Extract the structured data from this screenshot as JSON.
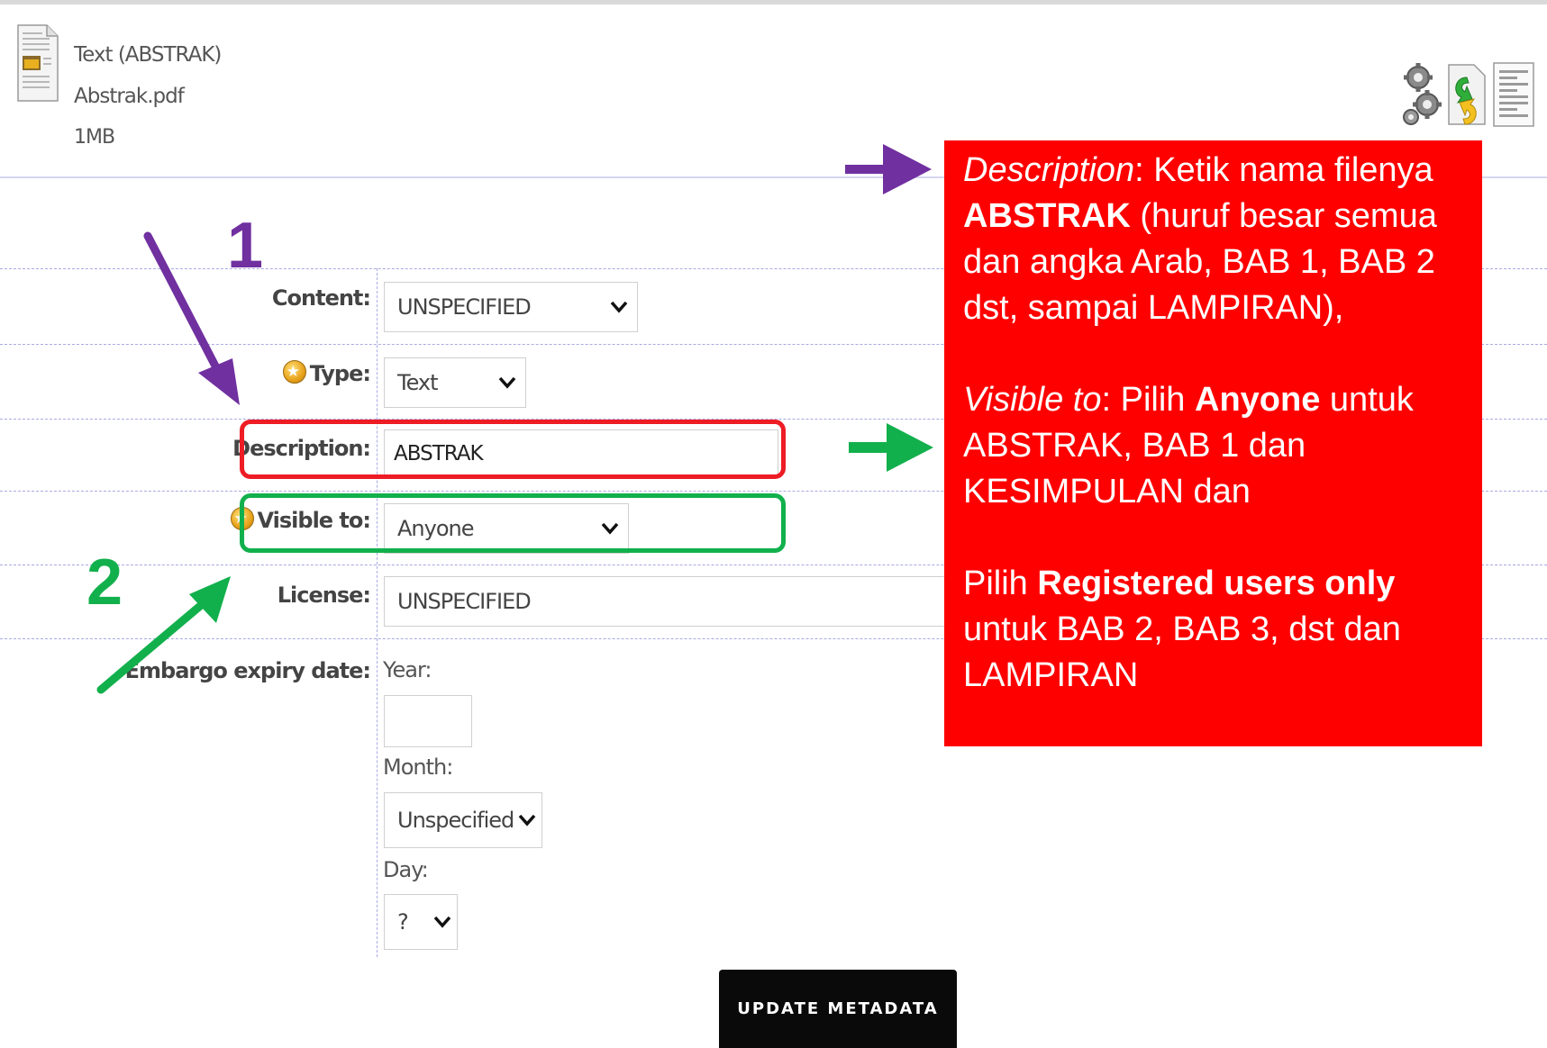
{
  "file": {
    "title": "Text (ABSTRAK)",
    "filename": "Abstrak.pdf",
    "size": "1MB"
  },
  "form": {
    "content": {
      "label": "Content:",
      "value": "UNSPECIFIED"
    },
    "type": {
      "label": "Type:",
      "value": "Text"
    },
    "description": {
      "label": "Description:",
      "value": "ABSTRAK"
    },
    "visible_to": {
      "label": "Visible to:",
      "value": "Anyone"
    },
    "license": {
      "label": "License:",
      "value": "UNSPECIFIED"
    },
    "embargo": {
      "label": "Embargo expiry date:",
      "year_label": "Year:",
      "year_value": "",
      "month_label": "Month:",
      "month_value": "Unspecified",
      "day_label": "Day:",
      "day_value": "?"
    },
    "update_button": "UPDATE METADATA"
  },
  "annotations": {
    "step1": "1",
    "step2": "2",
    "callout": {
      "desc_term": "Description",
      "desc_text1": ": Ketik nama filenya ",
      "desc_bold": "ABSTRAK",
      "desc_text2": " (huruf besar semua dan angka Arab, BAB 1, BAB 2 dst, sampai LAMPIRAN),",
      "vis_term": "Visible to",
      "vis_text1": ": Pilih ",
      "vis_bold": "Anyone",
      "vis_text2": " untuk ABSTRAK, BAB 1 dan KESIMPULAN dan",
      "reg_text1": "Pilih ",
      "reg_bold": "Registered users only",
      "reg_text2": " untuk BAB 2, BAB 3, dst dan LAMPIRAN"
    },
    "colors": {
      "purple": "#7030a0",
      "green": "#12b04c",
      "red": "#ee1c24",
      "callout_bg": "#ff0000"
    }
  },
  "icons": [
    "document-pdf-icon",
    "gear-icon",
    "replace-file-icon",
    "details-list-icon",
    "chevron-down-icon",
    "required-star-icon"
  ]
}
